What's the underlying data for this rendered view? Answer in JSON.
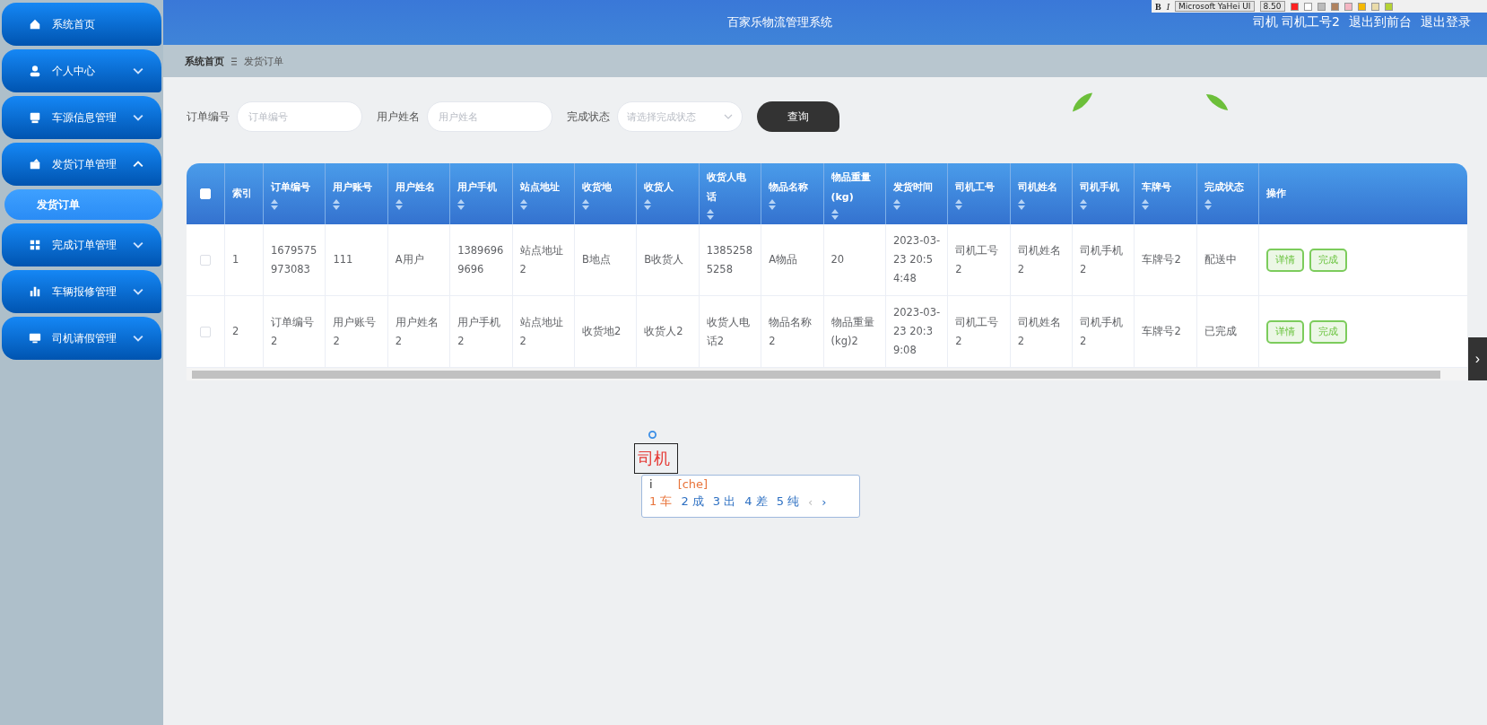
{
  "sidebar": {
    "items": [
      {
        "label": "系统首页",
        "kind": "menu"
      },
      {
        "label": "个人中心",
        "kind": "menu",
        "expanded": false
      },
      {
        "label": "车源信息管理",
        "kind": "menu",
        "expanded": false
      },
      {
        "label": "发货订单管理",
        "kind": "menu",
        "expanded": true
      },
      {
        "label": "发货订单",
        "kind": "submenu",
        "selected": true
      },
      {
        "label": "完成订单管理",
        "kind": "menu",
        "expanded": false
      },
      {
        "label": "车辆报修管理",
        "kind": "menu",
        "expanded": false
      },
      {
        "label": "司机请假管理",
        "kind": "menu",
        "expanded": false
      }
    ]
  },
  "header": {
    "title": "百家乐物流管理系统",
    "user": "司机 司机工号2",
    "links": [
      "退出到前台",
      "退出登录"
    ]
  },
  "editor_toolbar": {
    "bold": "B",
    "italic": "I",
    "font": "Microsoft YaHei UI",
    "size": "8.50"
  },
  "breadcrumb": [
    "系统首页",
    "发货订单"
  ],
  "search": {
    "fields": [
      {
        "label": "订单编号",
        "placeholder": "订单编号",
        "kind": "input"
      },
      {
        "label": "用户姓名",
        "placeholder": "用户姓名",
        "kind": "input"
      },
      {
        "label": "完成状态",
        "placeholder": "请选择完成状态",
        "kind": "select"
      }
    ],
    "button": "查询"
  },
  "table": {
    "select_all_checked": false,
    "columns": [
      {
        "label": "索引",
        "sortable": false
      },
      {
        "label": "订单编号",
        "sortable": true
      },
      {
        "label": "用户账号",
        "sortable": true
      },
      {
        "label": "用户姓名",
        "sortable": true
      },
      {
        "label": "用户手机",
        "sortable": true
      },
      {
        "label": "站点地址",
        "sortable": true
      },
      {
        "label": "收货地",
        "sortable": true
      },
      {
        "label": "收货人",
        "sortable": true
      },
      {
        "label": "收货人电话",
        "sortable": true
      },
      {
        "label": "物品名称",
        "sortable": true
      },
      {
        "label": "物品重量(kg)",
        "sortable": true
      },
      {
        "label": "发货时间",
        "sortable": true
      },
      {
        "label": "司机工号",
        "sortable": true
      },
      {
        "label": "司机姓名",
        "sortable": true
      },
      {
        "label": "司机手机",
        "sortable": true
      },
      {
        "label": "车牌号",
        "sortable": true
      },
      {
        "label": "完成状态",
        "sortable": true
      },
      {
        "label": "操作",
        "sortable": false
      }
    ],
    "rows": [
      {
        "checked": false,
        "cells": [
          "1",
          "1679575973083",
          "111",
          "A用户",
          "13896969696",
          "站点地址2",
          "B地点",
          "B收货人",
          "13852585258",
          "A物品",
          "20",
          "2023-03-23 20:54:48",
          "司机工号2",
          "司机姓名2",
          "司机手机2",
          "车牌号2",
          "配送中"
        ],
        "actions": [
          "详情",
          "完成"
        ]
      },
      {
        "checked": false,
        "cells": [
          "2",
          "订单编号2",
          "用户账号2",
          "用户姓名2",
          "用户手机2",
          "站点地址2",
          "收货地2",
          "收货人2",
          "收货人电话2",
          "物品名称2",
          "物品重量(kg)2",
          "2023-03-23 20:39:08",
          "司机工号2",
          "司机姓名2",
          "司机手机2",
          "车牌号2",
          "已完成"
        ],
        "actions": [
          "详情",
          "完成"
        ]
      }
    ]
  },
  "text_box": {
    "value": "司机"
  },
  "ime": {
    "input": "i",
    "pinyin": "[che]",
    "candidates": [
      {
        "index": "1",
        "text": "车",
        "selected": true
      },
      {
        "index": "2",
        "text": "成",
        "selected": false
      },
      {
        "index": "3",
        "text": "出",
        "selected": false
      },
      {
        "index": "4",
        "text": "差",
        "selected": false
      },
      {
        "index": "5",
        "text": "纯",
        "selected": false
      }
    ],
    "prev": "‹",
    "next": "›"
  },
  "side_tab": "›"
}
